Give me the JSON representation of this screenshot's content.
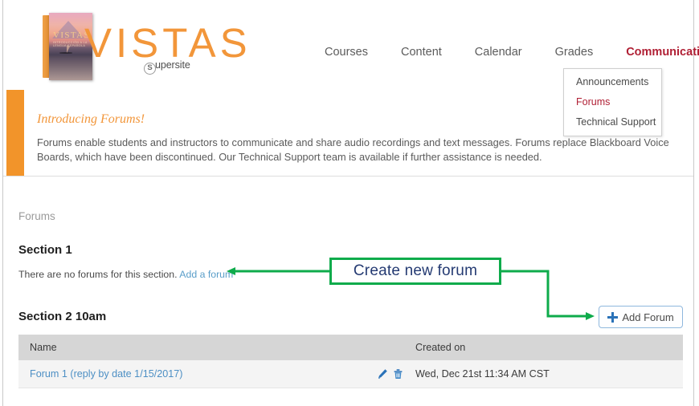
{
  "header": {
    "brand": "VISTAS",
    "supersite_mark": "S",
    "supersite_label": "upersite",
    "book_cover_title": "VISTAS",
    "book_cover_subtitle": "INTRODUCCIÓN A LA LENGUA ESPAÑOLA"
  },
  "nav": {
    "items": [
      {
        "label": "Courses",
        "active": false
      },
      {
        "label": "Content",
        "active": false
      },
      {
        "label": "Calendar",
        "active": false
      },
      {
        "label": "Grades",
        "active": false
      },
      {
        "label": "Communication",
        "active": true
      }
    ]
  },
  "dropdown": {
    "items": [
      {
        "label": "Announcements",
        "selected": false
      },
      {
        "label": "Forums",
        "selected": true
      },
      {
        "label": "Technical Support",
        "selected": false
      }
    ]
  },
  "banner": {
    "title": "Introducing Forums!",
    "body": "Forums enable students and instructors to communicate and share audio recordings and text messages. Forums replace Blackboard Voice Boards, which have been discontinued. Our Technical Support team is available if further assistance is needed."
  },
  "content": {
    "breadcrumb": "Forums",
    "section1": {
      "title": "Section 1",
      "empty_text": "There are no forums for this section.",
      "add_link": "Add a forum"
    },
    "section2": {
      "title": "Section 2 10am",
      "add_button_label": "Add Forum"
    },
    "table": {
      "columns": [
        "Name",
        "Created on"
      ],
      "rows": [
        {
          "name": "Forum 1 (reply by date 1/15/2017)",
          "created_on": "Wed, Dec 21st 11:34 AM CST",
          "edit_icon": "pencil-icon",
          "delete_icon": "trash-icon"
        }
      ]
    }
  },
  "annotation": {
    "callout_text": "Create new forum",
    "color": "#0eab4b",
    "text_color": "#243a72"
  },
  "colors": {
    "brand_orange": "#f2963a",
    "banner_bar": "#f2942a",
    "nav_active_red": "#b01f34",
    "link_blue": "#5a9ec9",
    "table_header_gray": "#d6d6d6",
    "table_row_gray": "#f4f4f4",
    "button_border_blue": "#8fb8dd",
    "icon_blue": "#2a72b8"
  }
}
